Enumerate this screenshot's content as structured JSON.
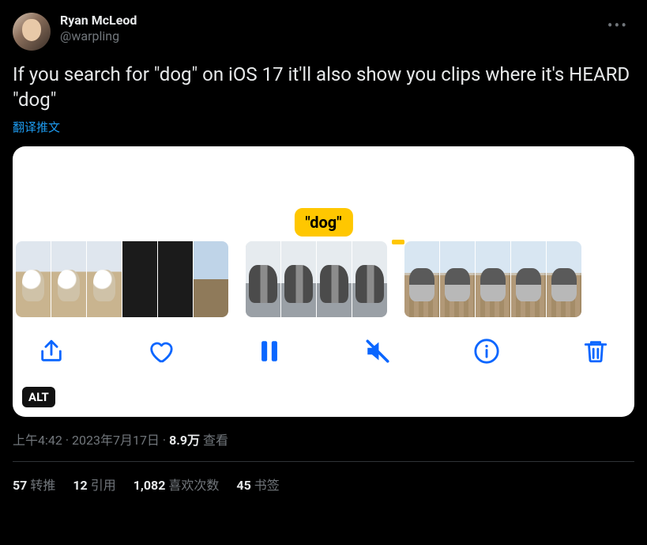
{
  "author": {
    "display_name": "Ryan McLeod",
    "handle": "@warpling"
  },
  "tweet_text": "If you search for \"dog\" on iOS 17 it'll also show you clips where it's HEARD \"dog\"",
  "translate_label": "翻译推文",
  "media": {
    "caption_pill": "\"dog\"",
    "alt_badge": "ALT"
  },
  "meta": {
    "time": "上午4:42",
    "date": "2023年7月17日",
    "views_count": "8.9万",
    "views_label": "查看"
  },
  "stats": {
    "retweets_count": "57",
    "retweets_label": "转推",
    "quotes_count": "12",
    "quotes_label": "引用",
    "likes_count": "1,082",
    "likes_label": "喜欢次数",
    "bookmarks_count": "45",
    "bookmarks_label": "书签"
  }
}
